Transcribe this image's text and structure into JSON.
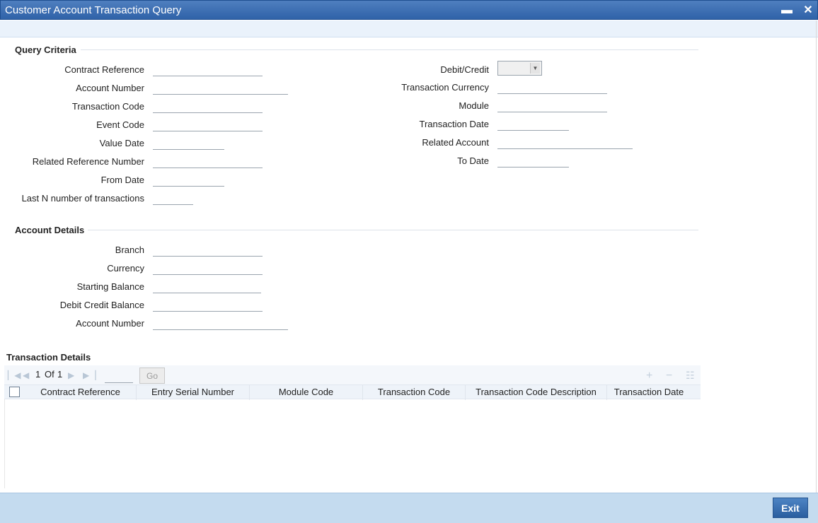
{
  "window": {
    "title": "Customer Account Transaction Query",
    "minimize_symbol": "▬",
    "close_symbol": "✕"
  },
  "query_criteria": {
    "title": "Query Criteria",
    "left_fields": [
      {
        "label": "Contract Reference",
        "value": ""
      },
      {
        "label": "Account Number",
        "value": ""
      },
      {
        "label": "Transaction Code",
        "value": ""
      },
      {
        "label": "Event Code",
        "value": ""
      },
      {
        "label": "Value Date",
        "value": ""
      },
      {
        "label": "Related Reference Number",
        "value": ""
      },
      {
        "label": "From Date",
        "value": ""
      },
      {
        "label": "Last N number of transactions",
        "value": ""
      }
    ],
    "right_fields": [
      {
        "label": "Debit/Credit",
        "value": ""
      },
      {
        "label": "Transaction Currency",
        "value": ""
      },
      {
        "label": "Module",
        "value": ""
      },
      {
        "label": "Transaction Date",
        "value": ""
      },
      {
        "label": "Related Account",
        "value": ""
      },
      {
        "label": "To Date",
        "value": ""
      }
    ]
  },
  "account_details": {
    "title": "Account Details",
    "fields": [
      {
        "label": "Branch",
        "value": ""
      },
      {
        "label": "Currency",
        "value": ""
      },
      {
        "label": "Starting Balance",
        "value": ""
      },
      {
        "label": "Debit Credit Balance",
        "value": ""
      },
      {
        "label": "Account Number",
        "value": ""
      }
    ]
  },
  "transaction_details": {
    "title": "Transaction Details",
    "pagination": {
      "current": "1",
      "of_label": "Of",
      "total": "1",
      "go_label": "Go"
    },
    "columns": [
      "Contract Reference",
      "Entry Serial Number",
      "Module Code",
      "Transaction Code",
      "Transaction Code Description",
      "Transaction Date"
    ],
    "rows": []
  },
  "footer": {
    "exit_label": "Exit"
  }
}
